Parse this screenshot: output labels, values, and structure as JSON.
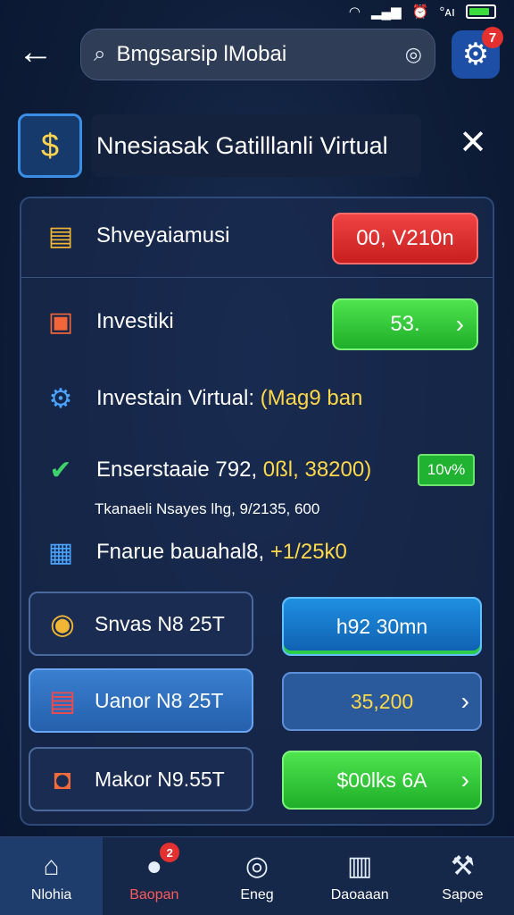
{
  "status_bar": {
    "wifi_icon": "wifi-icon",
    "signal_text": "°ᴀı",
    "alarm_icon": "alarm-icon",
    "battery_icon": "battery-icon"
  },
  "search": {
    "value": "Bmgsarsip lMobai"
  },
  "settings": {
    "badge": "7"
  },
  "header": {
    "title": "Nnesiasak Gatilllanli Virtual"
  },
  "rows": {
    "r1": {
      "label": "Shveyaiamusi",
      "value": "00, V210n"
    },
    "r2": {
      "label": "Investiki",
      "value": "53."
    },
    "r3": {
      "label": "Investain Virtual: ",
      "highlight": "(Mag9 ban"
    },
    "r4": {
      "label": "Enserstaaie 792, ",
      "highlight": "0ßl, 38200)",
      "badge": "10v%"
    },
    "r5": {
      "text": "Tkanaeli Nsayes lhg, 9/2135, 600"
    },
    "r6": {
      "label": "Fnarue bauahal8, ",
      "highlight": "+1/25k0"
    }
  },
  "cards": [
    {
      "label": "Snvas N8 25T",
      "value": "h92 30mn"
    },
    {
      "label": "Uanor N8 25T",
      "value": "35,200"
    },
    {
      "label": "Makor N9.55T",
      "value": "$00lks 6A"
    }
  ],
  "tabs": [
    {
      "label": "Nlohia",
      "icon": "home-icon"
    },
    {
      "label": "Baopan",
      "icon": "chat-icon",
      "badge": "2"
    },
    {
      "label": "Eneg",
      "icon": "badge-icon"
    },
    {
      "label": "Daoaaan",
      "icon": "document-icon"
    },
    {
      "label": "Sapoe",
      "icon": "tools-icon"
    }
  ],
  "colors": {
    "accent": "#1c4fa5",
    "danger": "#e4302e",
    "success": "#2ccf45",
    "highlight": "#ffd84a"
  }
}
